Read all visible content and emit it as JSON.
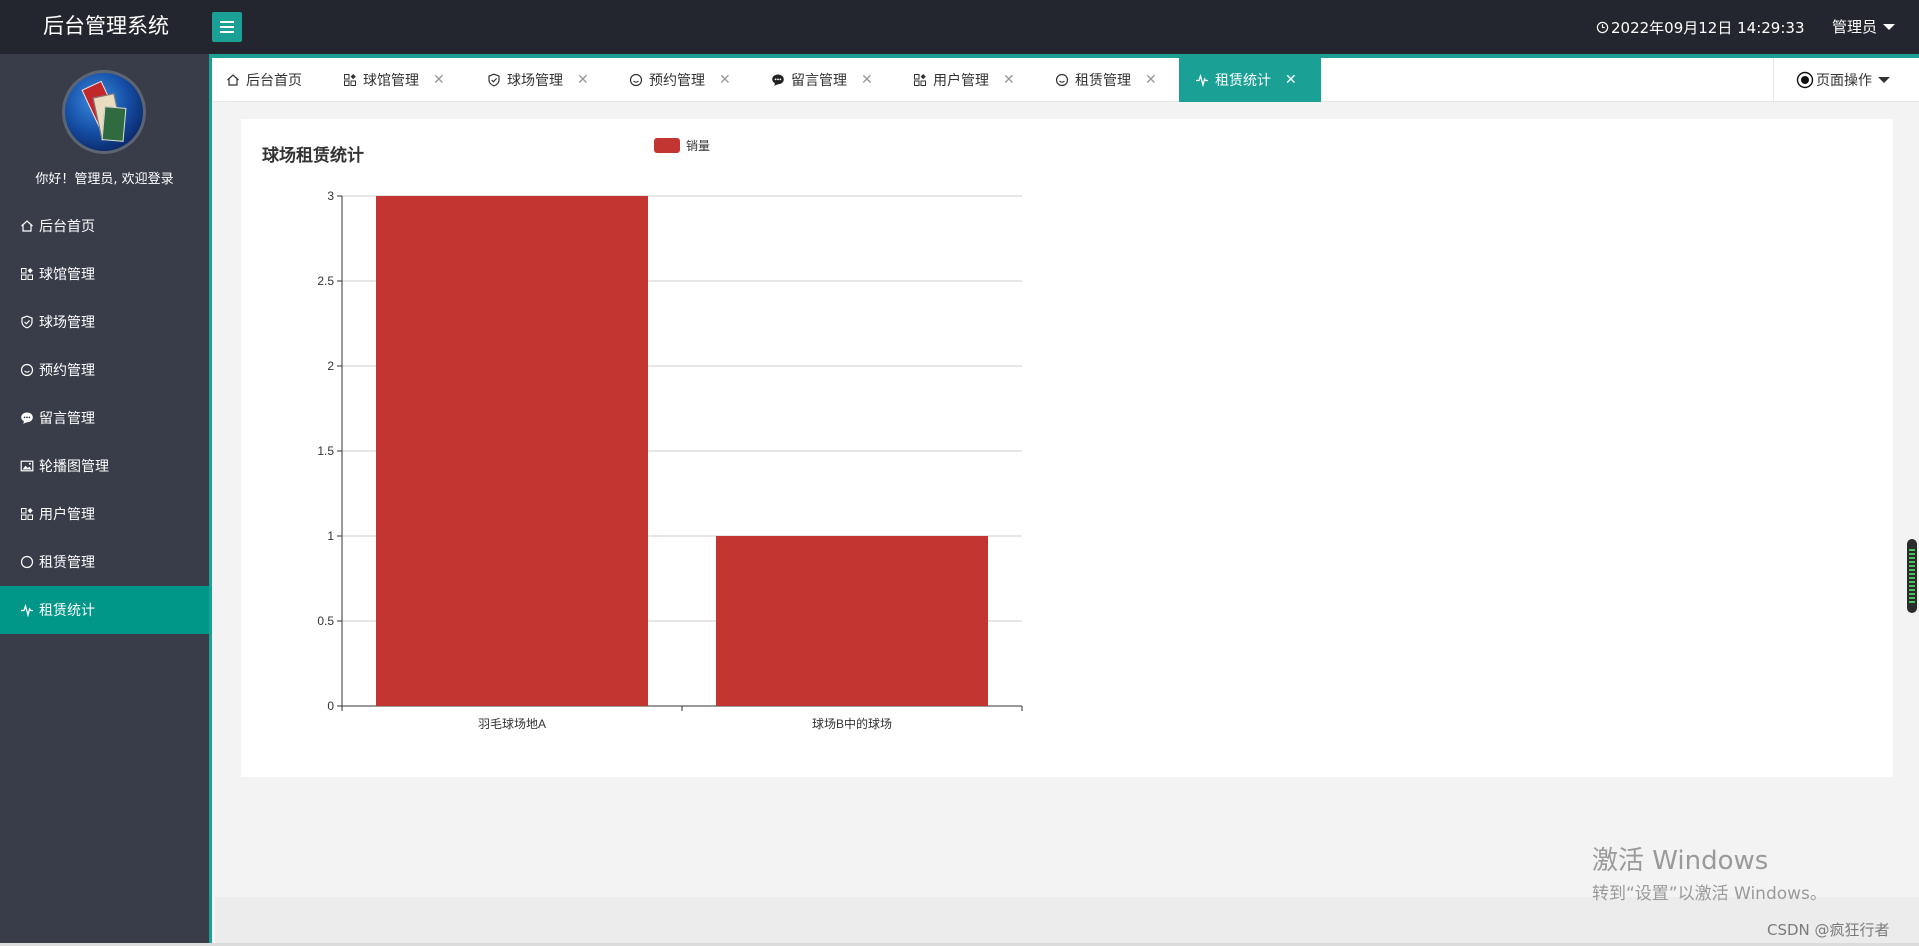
{
  "app": {
    "title": "后台管理系统",
    "datetime": "2022年09月12日 14:29:33",
    "user_menu_label": "管理员"
  },
  "sidebar": {
    "welcome": "你好！管理员, 欢迎登录",
    "items": [
      {
        "label": "后台首页",
        "icon": "home-icon"
      },
      {
        "label": "球馆管理",
        "icon": "grid-icon"
      },
      {
        "label": "球场管理",
        "icon": "shield-icon"
      },
      {
        "label": "预约管理",
        "icon": "smile-icon"
      },
      {
        "label": "留言管理",
        "icon": "chat-icon"
      },
      {
        "label": "轮播图管理",
        "icon": "image-icon"
      },
      {
        "label": "用户管理",
        "icon": "grid-icon"
      },
      {
        "label": "租赁管理",
        "icon": "circle-icon"
      },
      {
        "label": "租赁统计",
        "icon": "pulse-icon",
        "active": true
      }
    ]
  },
  "tabs": [
    {
      "label": "后台首页",
      "icon": "home-icon",
      "closable": false
    },
    {
      "label": "球馆管理",
      "icon": "grid-icon",
      "closable": true
    },
    {
      "label": "球场管理",
      "icon": "shield-icon",
      "closable": true
    },
    {
      "label": "预约管理",
      "icon": "smile-icon",
      "closable": true
    },
    {
      "label": "留言管理",
      "icon": "chat-icon",
      "closable": true
    },
    {
      "label": "用户管理",
      "icon": "grid-icon",
      "closable": true
    },
    {
      "label": "租赁管理",
      "icon": "smile-icon",
      "closable": true
    },
    {
      "label": "租赁统计",
      "icon": "pulse-icon",
      "closable": true,
      "active": true
    }
  ],
  "page_ops_label": "页面操作",
  "colors": {
    "accent": "#1aa094",
    "sidebar_bg": "#393d49",
    "header_bg": "#23262e",
    "bar": "#c23531"
  },
  "chart_data": {
    "type": "bar",
    "title": "球场租赁统计",
    "categories": [
      "羽毛球场地A",
      "球场B中的球场"
    ],
    "series": [
      {
        "name": "销量",
        "values": [
          3,
          1
        ]
      }
    ],
    "ylim": [
      0,
      3
    ],
    "yticks": [
      "0",
      "0.5",
      "1",
      "1.5",
      "2",
      "2.5",
      "3"
    ],
    "grid": true,
    "legend_position": "top"
  },
  "watermark": {
    "line1": "激活 Windows",
    "line2": "转到“设置”以激活 Windows。"
  },
  "csdn_credit": "CSDN @疯狂行者"
}
